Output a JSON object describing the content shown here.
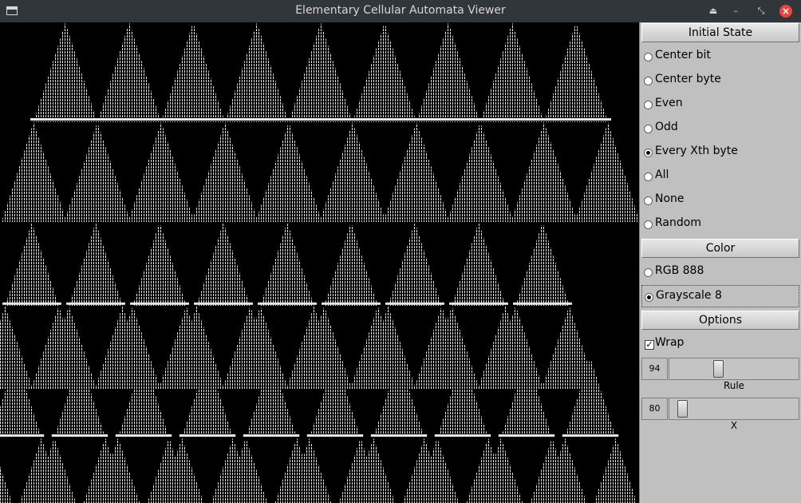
{
  "window": {
    "title": "Elementary Cellular Automata Viewer"
  },
  "initial_state": {
    "header": "Initial State",
    "options": [
      {
        "label": "Center bit",
        "checked": false
      },
      {
        "label": "Center byte",
        "checked": false
      },
      {
        "label": "Even",
        "checked": false
      },
      {
        "label": "Odd",
        "checked": false
      },
      {
        "label": "Every Xth byte",
        "checked": true
      },
      {
        "label": "All",
        "checked": false
      },
      {
        "label": "None",
        "checked": false
      },
      {
        "label": "Random",
        "checked": false
      }
    ]
  },
  "color": {
    "header": "Color",
    "options": [
      {
        "label": "RGB 888",
        "checked": false
      },
      {
        "label": "Grayscale 8",
        "checked": true
      }
    ]
  },
  "options": {
    "header": "Options",
    "wrap_label": "Wrap",
    "wrap_checked": true,
    "rule_value": "94",
    "rule_label": "Rule",
    "rule_level": 0.37,
    "x_value": "80",
    "x_label": "X",
    "x_level": 0.07
  }
}
